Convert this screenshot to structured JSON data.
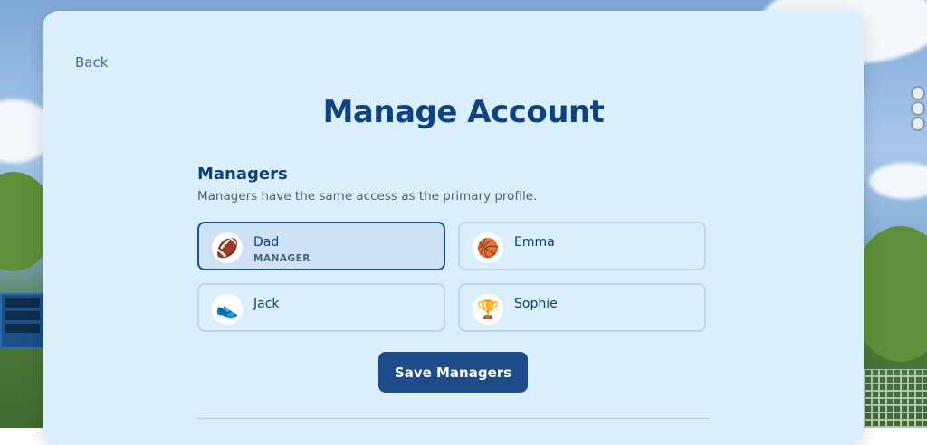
{
  "header": {
    "back_label": "Back",
    "title": "Manage Account"
  },
  "managers": {
    "title": "Managers",
    "description": "Managers have the same access as the primary profile.",
    "profiles": [
      {
        "name": "Dad",
        "role": "MANAGER",
        "icon": "football-icon",
        "glyph": "🏈",
        "selected": true
      },
      {
        "name": "Emma",
        "role": "",
        "icon": "basketball-icon",
        "glyph": "🏀",
        "selected": false
      },
      {
        "name": "Jack",
        "role": "",
        "icon": "sneaker-icon",
        "glyph": "👟",
        "selected": false
      },
      {
        "name": "Sophie",
        "role": "",
        "icon": "trophy-icon",
        "glyph": "🏆",
        "selected": false
      }
    ],
    "save_label": "Save Managers"
  },
  "colors": {
    "accent": "#1e4b8a",
    "title": "#0d4285",
    "card": "#dbeefc"
  }
}
